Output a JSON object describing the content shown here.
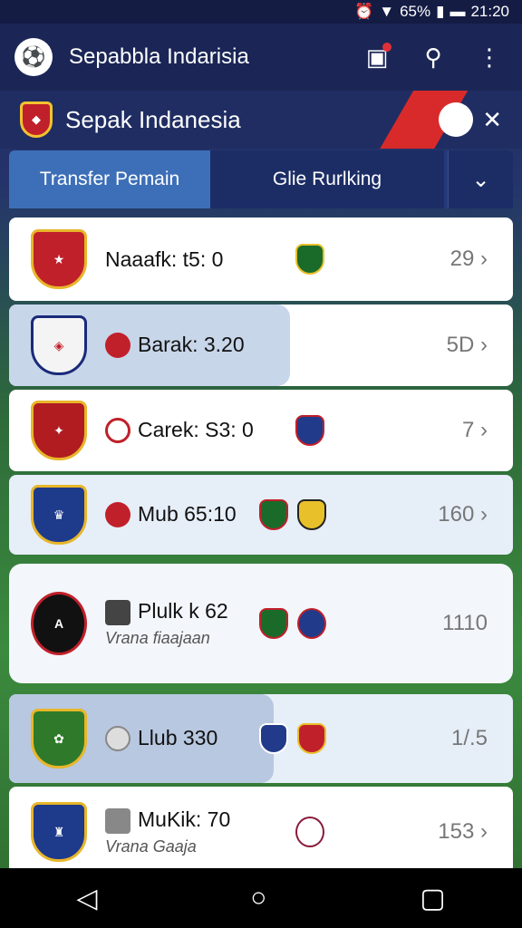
{
  "status": {
    "battery": "65%",
    "time": "21:20"
  },
  "appbar": {
    "title": "Sepabbla Indarisia"
  },
  "subbar": {
    "title": "Sepak Indanesia"
  },
  "tabs": {
    "active": "Transfer Pemain",
    "second": "Glie Rurlking"
  },
  "rows": [
    {
      "main": "Naaafk: t5: 0",
      "sub": "",
      "value": "29"
    },
    {
      "main": "Barak: 3.20",
      "sub": "",
      "value": "5D"
    },
    {
      "main": "Carek: S3: 0",
      "sub": "",
      "value": "7"
    },
    {
      "main": "Mub 65:10",
      "sub": "",
      "value": "160"
    },
    {
      "main": "Plulk k 62",
      "sub": "Vrana fiaajaan",
      "value": "1110"
    },
    {
      "main": "Llub 330",
      "sub": "",
      "value": "1/.5"
    },
    {
      "main": "MuKik: 70",
      "sub": "Vrana Gaaja",
      "value": "153"
    }
  ],
  "icons": {
    "status": [
      "alarm-icon",
      "wifi-icon",
      "signal-icon",
      "battery-icon"
    ],
    "appbar": [
      "calendar-icon",
      "search-icon",
      "more-vert-icon"
    ],
    "nav": [
      "back-icon",
      "home-icon",
      "recents-icon"
    ]
  },
  "colors": {
    "appbar": "#1b2656",
    "tab_active": "#3d6fb8",
    "accent_red": "#d82a2a"
  }
}
